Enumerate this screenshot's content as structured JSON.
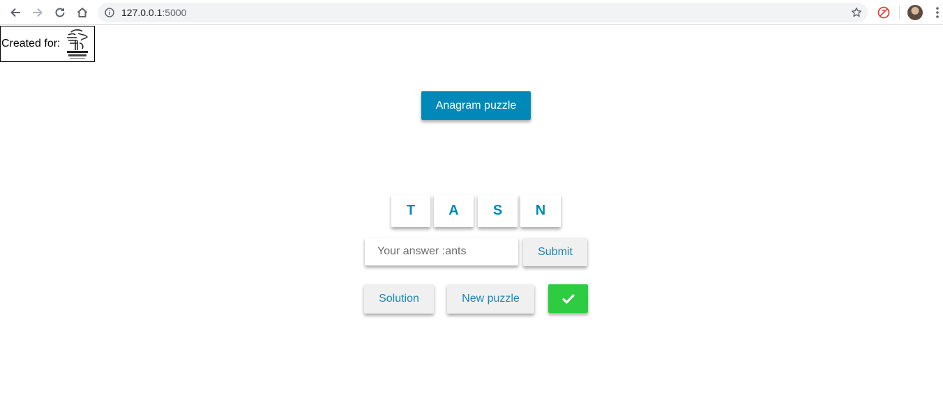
{
  "browser": {
    "url_host": "127.0.0.1",
    "url_port": ":5000",
    "icons": [
      "back-icon",
      "forward-icon",
      "reload-icon",
      "home-icon",
      "info-icon",
      "star-icon",
      "extension-icon",
      "avatar",
      "menu-icon"
    ]
  },
  "header": {
    "created_label": "Created for:",
    "logo_icon": "kemuri-logo"
  },
  "main": {
    "title_button": "Anagram puzzle",
    "letters": [
      "T",
      "A",
      "S",
      "N"
    ],
    "answer": {
      "value": "",
      "placeholder": "Your answer :ants"
    },
    "submit_label": "Submit",
    "solution_label": "Solution",
    "new_puzzle_label": "New puzzle",
    "check_icon": "check-icon"
  },
  "colors": {
    "accent": "#0089b8",
    "success": "#2ecc40",
    "button_grey": "#f0f0f0"
  }
}
